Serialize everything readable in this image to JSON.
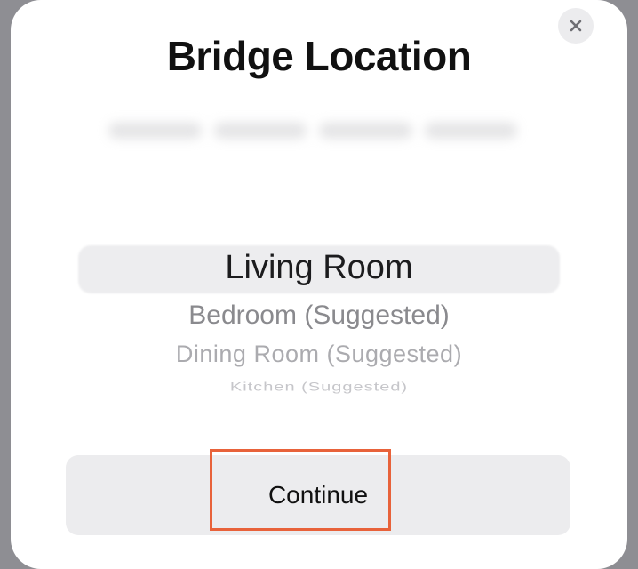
{
  "dialog": {
    "title": "Bridge Location",
    "close_icon": "close-icon"
  },
  "picker": {
    "selected": "Living Room",
    "options": [
      "Bedroom (Suggested)",
      "Dining Room (Suggested)",
      "Kitchen (Suggested)"
    ]
  },
  "actions": {
    "continue_label": "Continue"
  },
  "colors": {
    "annotation_frame": "#e8623a",
    "sheet_background": "#ffffff",
    "button_background": "#ececee"
  }
}
